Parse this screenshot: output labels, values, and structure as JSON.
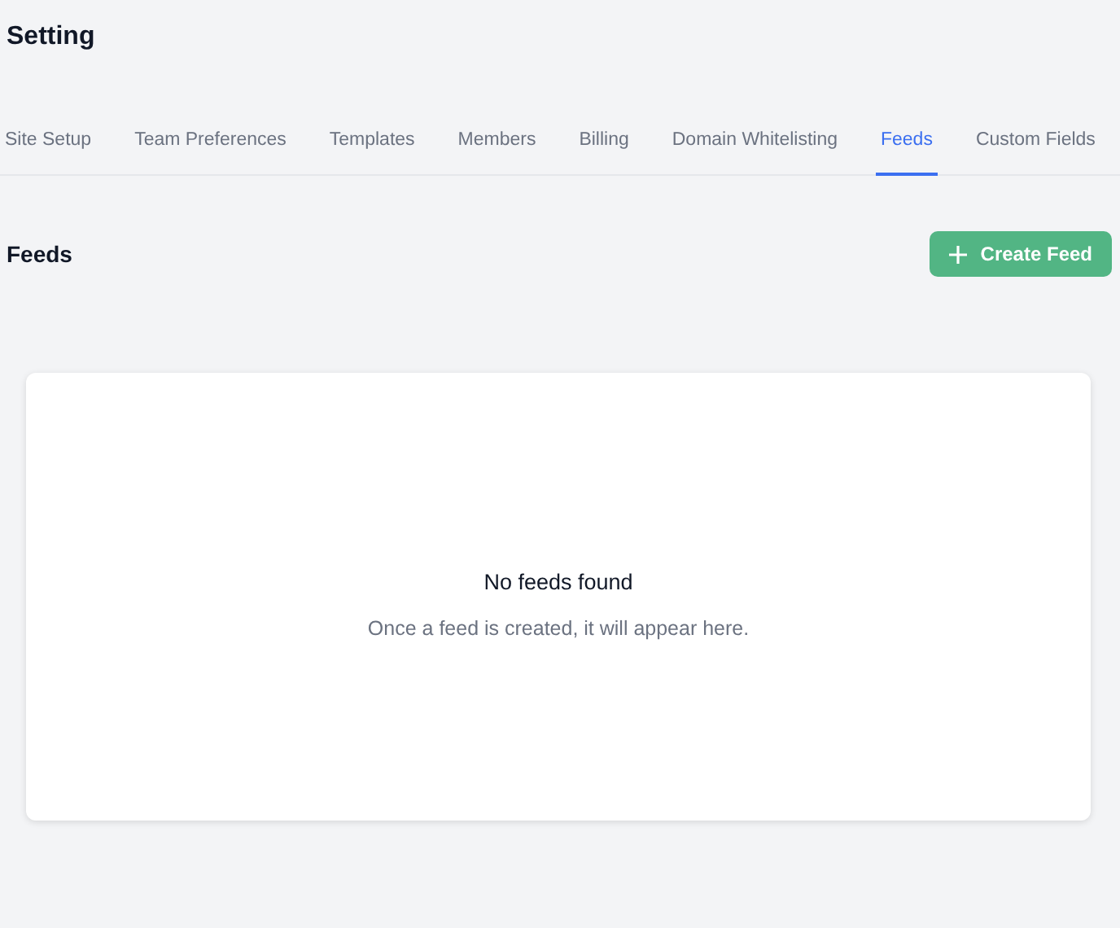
{
  "page": {
    "title": "Setting"
  },
  "tabs": [
    {
      "label": "Site Setup",
      "selected": false
    },
    {
      "label": "Team Preferences",
      "selected": false
    },
    {
      "label": "Templates",
      "selected": false
    },
    {
      "label": "Members",
      "selected": false
    },
    {
      "label": "Billing",
      "selected": false
    },
    {
      "label": "Domain Whitelisting",
      "selected": false
    },
    {
      "label": "Feeds",
      "selected": true
    },
    {
      "label": "Custom Fields",
      "selected": false
    }
  ],
  "section": {
    "title": "Feeds",
    "button": "Create Feed"
  },
  "empty_state": {
    "title": "No feeds found",
    "message": "Once a feed is created, it will appear here."
  }
}
